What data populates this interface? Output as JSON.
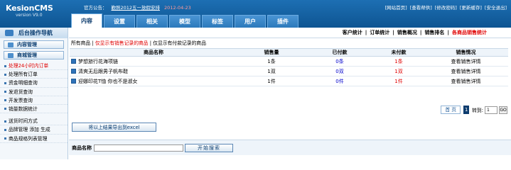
{
  "app": {
    "name": "KesionCMS",
    "version": "version V9.0"
  },
  "header": {
    "official_label": "官方公告：",
    "notice": "歡照2012五一放假安排",
    "notice_date": "2012-04-23",
    "links": [
      "[网站首页]",
      "[查看帮供]",
      "[修改密码]",
      "[更新缓存]",
      "[安全退出]"
    ]
  },
  "tabs": [
    "内容",
    "设置",
    "相关",
    "模型",
    "标签",
    "用户",
    "插件"
  ],
  "sidebar": {
    "title": "后台操作导航",
    "buttons": [
      "内容管理",
      "商城管理"
    ],
    "items": [
      "处理24小时内订单",
      "处理所有订单",
      "资金明细查询",
      "发退货查询",
      "开发票查询",
      "销量数据统计"
    ],
    "items2": [
      "送货时间方式",
      "品牌管理 添加 生成",
      "商品规格列表管理"
    ]
  },
  "subnav": [
    "客户统计",
    "订单统计",
    "销售概况",
    "销售排名",
    "各商品销售统计"
  ],
  "filter": {
    "all": "所有商品",
    "sold": "仅显示有销售记录的商品",
    "paid": "仅显示有付款记录的商品",
    "sep": "|"
  },
  "table": {
    "headers": [
      "商品名称",
      "销售量",
      "已付款",
      "未付款",
      "销售情况"
    ],
    "rows": [
      {
        "name": "梦想旅行花海项链",
        "qty": "1条",
        "paid": "0条",
        "unpaid": "1条",
        "action": "查看销售详情"
      },
      {
        "name": "清爽无后跟男子帆布鞋",
        "qty": "1双",
        "paid": "0双",
        "unpaid": "1双",
        "action": "查看销售详情"
      },
      {
        "name": "迎娜印花T恤 你也不是淑女",
        "qty": "1件",
        "paid": "0件",
        "unpaid": "1件",
        "action": "查看销售详情"
      }
    ]
  },
  "pager": {
    "first": "首 页",
    "current": "1",
    "goto_label": "转到:",
    "goto_value": "1",
    "go": "GO"
  },
  "export_label": "将以上结果导出到excel",
  "search": {
    "label": "商品名称",
    "button": "开始搜索"
  }
}
